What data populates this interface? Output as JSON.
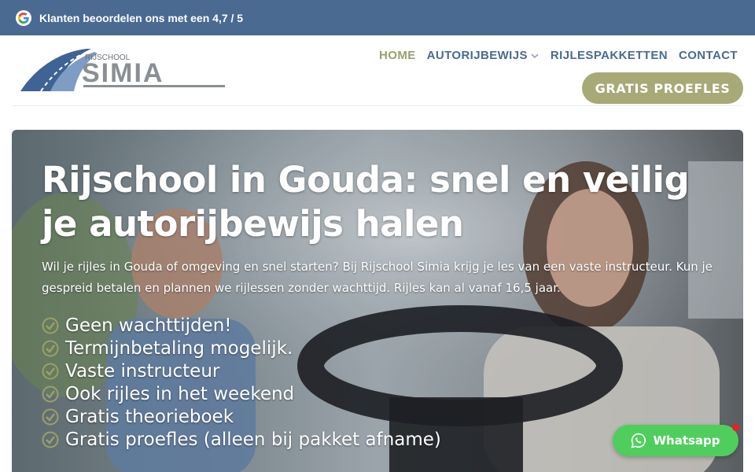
{
  "topbar": {
    "rating_text": "Klanten beoordelen ons met een 4,7 / 5",
    "google_icon": "google-icon"
  },
  "logo": {
    "small_text": "RIJSCHOOL",
    "brand_text": "SIMIA"
  },
  "nav": {
    "items": [
      {
        "label": "HOME",
        "active": true
      },
      {
        "label": "AUTORIJBEWIJS",
        "has_dropdown": true
      },
      {
        "label": "RIJLESPAKKETTEN"
      },
      {
        "label": "CONTACT"
      }
    ],
    "cta_label": "GRATIS PROEFLES"
  },
  "hero": {
    "title": "Rijschool in Gouda: snel en veilig je autorijbewijs halen",
    "intro": "Wil je rijles in Gouda of omgeving en snel starten? Bij Rijschool Simia krijg je les van een vaste instructeur. Kun je gespreid betalen en plannen we rijlessen zonder wachttijd. Rijles kan al vanaf 16,5 jaar.",
    "usps": [
      "Geen wachttijden!",
      "Termijnbetaling mogelijk.",
      "Vaste instructeur",
      "Ook rijles in het weekend",
      "Gratis theorieboek",
      "Gratis proefles (alleen bij pakket afname)"
    ]
  },
  "whatsapp": {
    "label": "Whatsapp"
  },
  "colors": {
    "topbar": "#4a6a91",
    "nav_text": "#4a6a91",
    "nav_active": "#9aa06a",
    "cta": "#a7a977",
    "whatsapp": "#4fce5d",
    "check": "#9aa06a"
  }
}
